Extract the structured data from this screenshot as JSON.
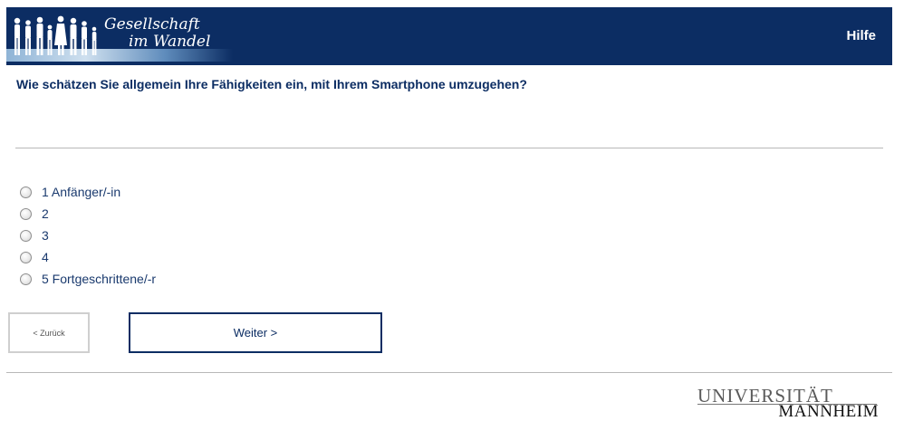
{
  "header": {
    "logo_line1": "Gesellschaft",
    "logo_line2": "im Wandel",
    "help_label": "Hilfe",
    "background_color": "#0c2d63"
  },
  "question": {
    "text": "Wie schätzen Sie allgemein Ihre Fähigkeiten ein, mit Ihrem Smartphone umzugehen?"
  },
  "options": [
    {
      "label": "1 Anfänger/-in",
      "selected": false
    },
    {
      "label": "2",
      "selected": false
    },
    {
      "label": "3",
      "selected": false
    },
    {
      "label": "4",
      "selected": false
    },
    {
      "label": "5 Fortgeschrittene/-r",
      "selected": false
    }
  ],
  "navigation": {
    "back_label": "< Zurück",
    "next_label": "Weiter >"
  },
  "footer": {
    "university_line1": "UNIVERSITÄT",
    "university_line2": "MANNHEIM"
  },
  "icons": {
    "logo_figures": "people-silhouettes-icon",
    "radio": "radio-button-icon"
  }
}
